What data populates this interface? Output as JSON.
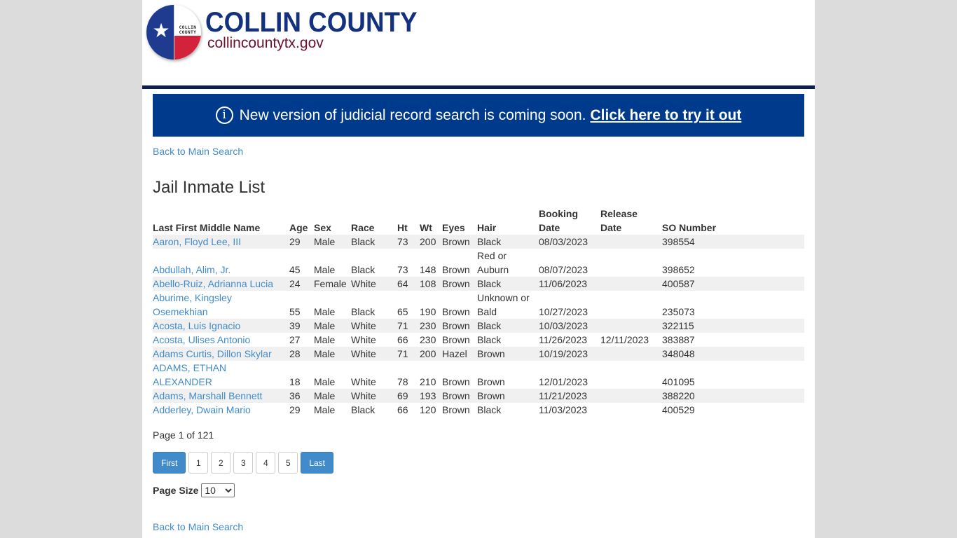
{
  "header": {
    "brand_title": "COLLIN COUNTY",
    "brand_url": "collincountytx.gov",
    "seal_text_line1": "COLLIN",
    "seal_text_line2": "COUNTY",
    "seal_icon": "star-icon",
    "colors": {
      "brand_blue": "#13317e",
      "brand_maroon": "#6b0f2a",
      "header_rule": "#0c1f4f"
    }
  },
  "banner": {
    "icon": "info-icon",
    "icon_glyph": "i",
    "message": "New version of judicial record search is coming soon.",
    "link_label": "Click here to try it out",
    "background": "#003a8c"
  },
  "nav": {
    "back_top_label": "Back to Main Search",
    "back_bottom_label": "Back to Main Search"
  },
  "page_title": "Jail Inmate List",
  "table": {
    "columns": [
      {
        "line1": "",
        "line2": "Last First Middle Name"
      },
      {
        "line1": "",
        "line2": "Age"
      },
      {
        "line1": "",
        "line2": "Sex"
      },
      {
        "line1": "",
        "line2": "Race"
      },
      {
        "line1": "",
        "line2": "Ht"
      },
      {
        "line1": "",
        "line2": "Wt"
      },
      {
        "line1": "",
        "line2": "Eyes"
      },
      {
        "line1": "",
        "line2": "Hair"
      },
      {
        "line1": "Booking",
        "line2": "Date"
      },
      {
        "line1": "Release",
        "line2": "Date"
      },
      {
        "line1": "",
        "line2": "SO Number"
      }
    ],
    "rows": [
      {
        "name": "Aaron, Floyd Lee, III",
        "age": "29",
        "sex": "Male",
        "race": "Black",
        "ht": "73",
        "wt": "200",
        "eyes": "Brown",
        "hair": "Black",
        "booking": "08/03/2023",
        "release": "",
        "so": "398554"
      },
      {
        "name": "Abdullah, Alim, Jr.",
        "age": "45",
        "sex": "Male",
        "race": "Black",
        "ht": "73",
        "wt": "148",
        "eyes": "Brown",
        "hair": "Red or Auburn",
        "booking": "08/07/2023",
        "release": "",
        "so": "398652"
      },
      {
        "name": "Abello-Ruiz, Adrianna Lucia",
        "age": "24",
        "sex": "Female",
        "race": "White",
        "ht": "64",
        "wt": "108",
        "eyes": "Brown",
        "hair": "Black",
        "booking": "11/06/2023",
        "release": "",
        "so": "400587"
      },
      {
        "name": "Aburime, Kingsley Osemekhian",
        "age": "55",
        "sex": "Male",
        "race": "Black",
        "ht": "65",
        "wt": "190",
        "eyes": "Brown",
        "hair": "Unknown or Bald",
        "booking": "10/27/2023",
        "release": "",
        "so": "235073"
      },
      {
        "name": "Acosta, Luis Ignacio",
        "age": "39",
        "sex": "Male",
        "race": "White",
        "ht": "71",
        "wt": "230",
        "eyes": "Brown",
        "hair": "Black",
        "booking": "10/03/2023",
        "release": "",
        "so": "322115"
      },
      {
        "name": "Acosta, Ulises Antonio",
        "age": "27",
        "sex": "Male",
        "race": "White",
        "ht": "66",
        "wt": "230",
        "eyes": "Brown",
        "hair": "Black",
        "booking": "11/26/2023",
        "release": "12/11/2023",
        "so": "383887"
      },
      {
        "name": "Adams Curtis, Dillon Skylar",
        "age": "28",
        "sex": "Male",
        "race": "White",
        "ht": "71",
        "wt": "200",
        "eyes": "Hazel",
        "hair": "Brown",
        "booking": "10/19/2023",
        "release": "",
        "so": "348048"
      },
      {
        "name": "ADAMS, ETHAN ALEXANDER",
        "age": "18",
        "sex": "Male",
        "race": "White",
        "ht": "78",
        "wt": "210",
        "eyes": "Brown",
        "hair": "Brown",
        "booking": "12/01/2023",
        "release": "",
        "so": "401095"
      },
      {
        "name": "Adams, Marshall Bennett",
        "age": "36",
        "sex": "Male",
        "race": "White",
        "ht": "69",
        "wt": "193",
        "eyes": "Brown",
        "hair": "Brown",
        "booking": "11/21/2023",
        "release": "",
        "so": "388220"
      },
      {
        "name": "Adderley, Dwain Mario",
        "age": "29",
        "sex": "Male",
        "race": "Black",
        "ht": "66",
        "wt": "120",
        "eyes": "Brown",
        "hair": "Black",
        "booking": "11/03/2023",
        "release": "",
        "so": "400529"
      }
    ]
  },
  "pagination": {
    "page_info": "Page 1 of 121",
    "first_label": "First",
    "pages": [
      "1",
      "2",
      "3",
      "4",
      "5"
    ],
    "last_label": "Last",
    "accent": "#428bca"
  },
  "page_size": {
    "label": "Page Size",
    "selected": "10"
  }
}
